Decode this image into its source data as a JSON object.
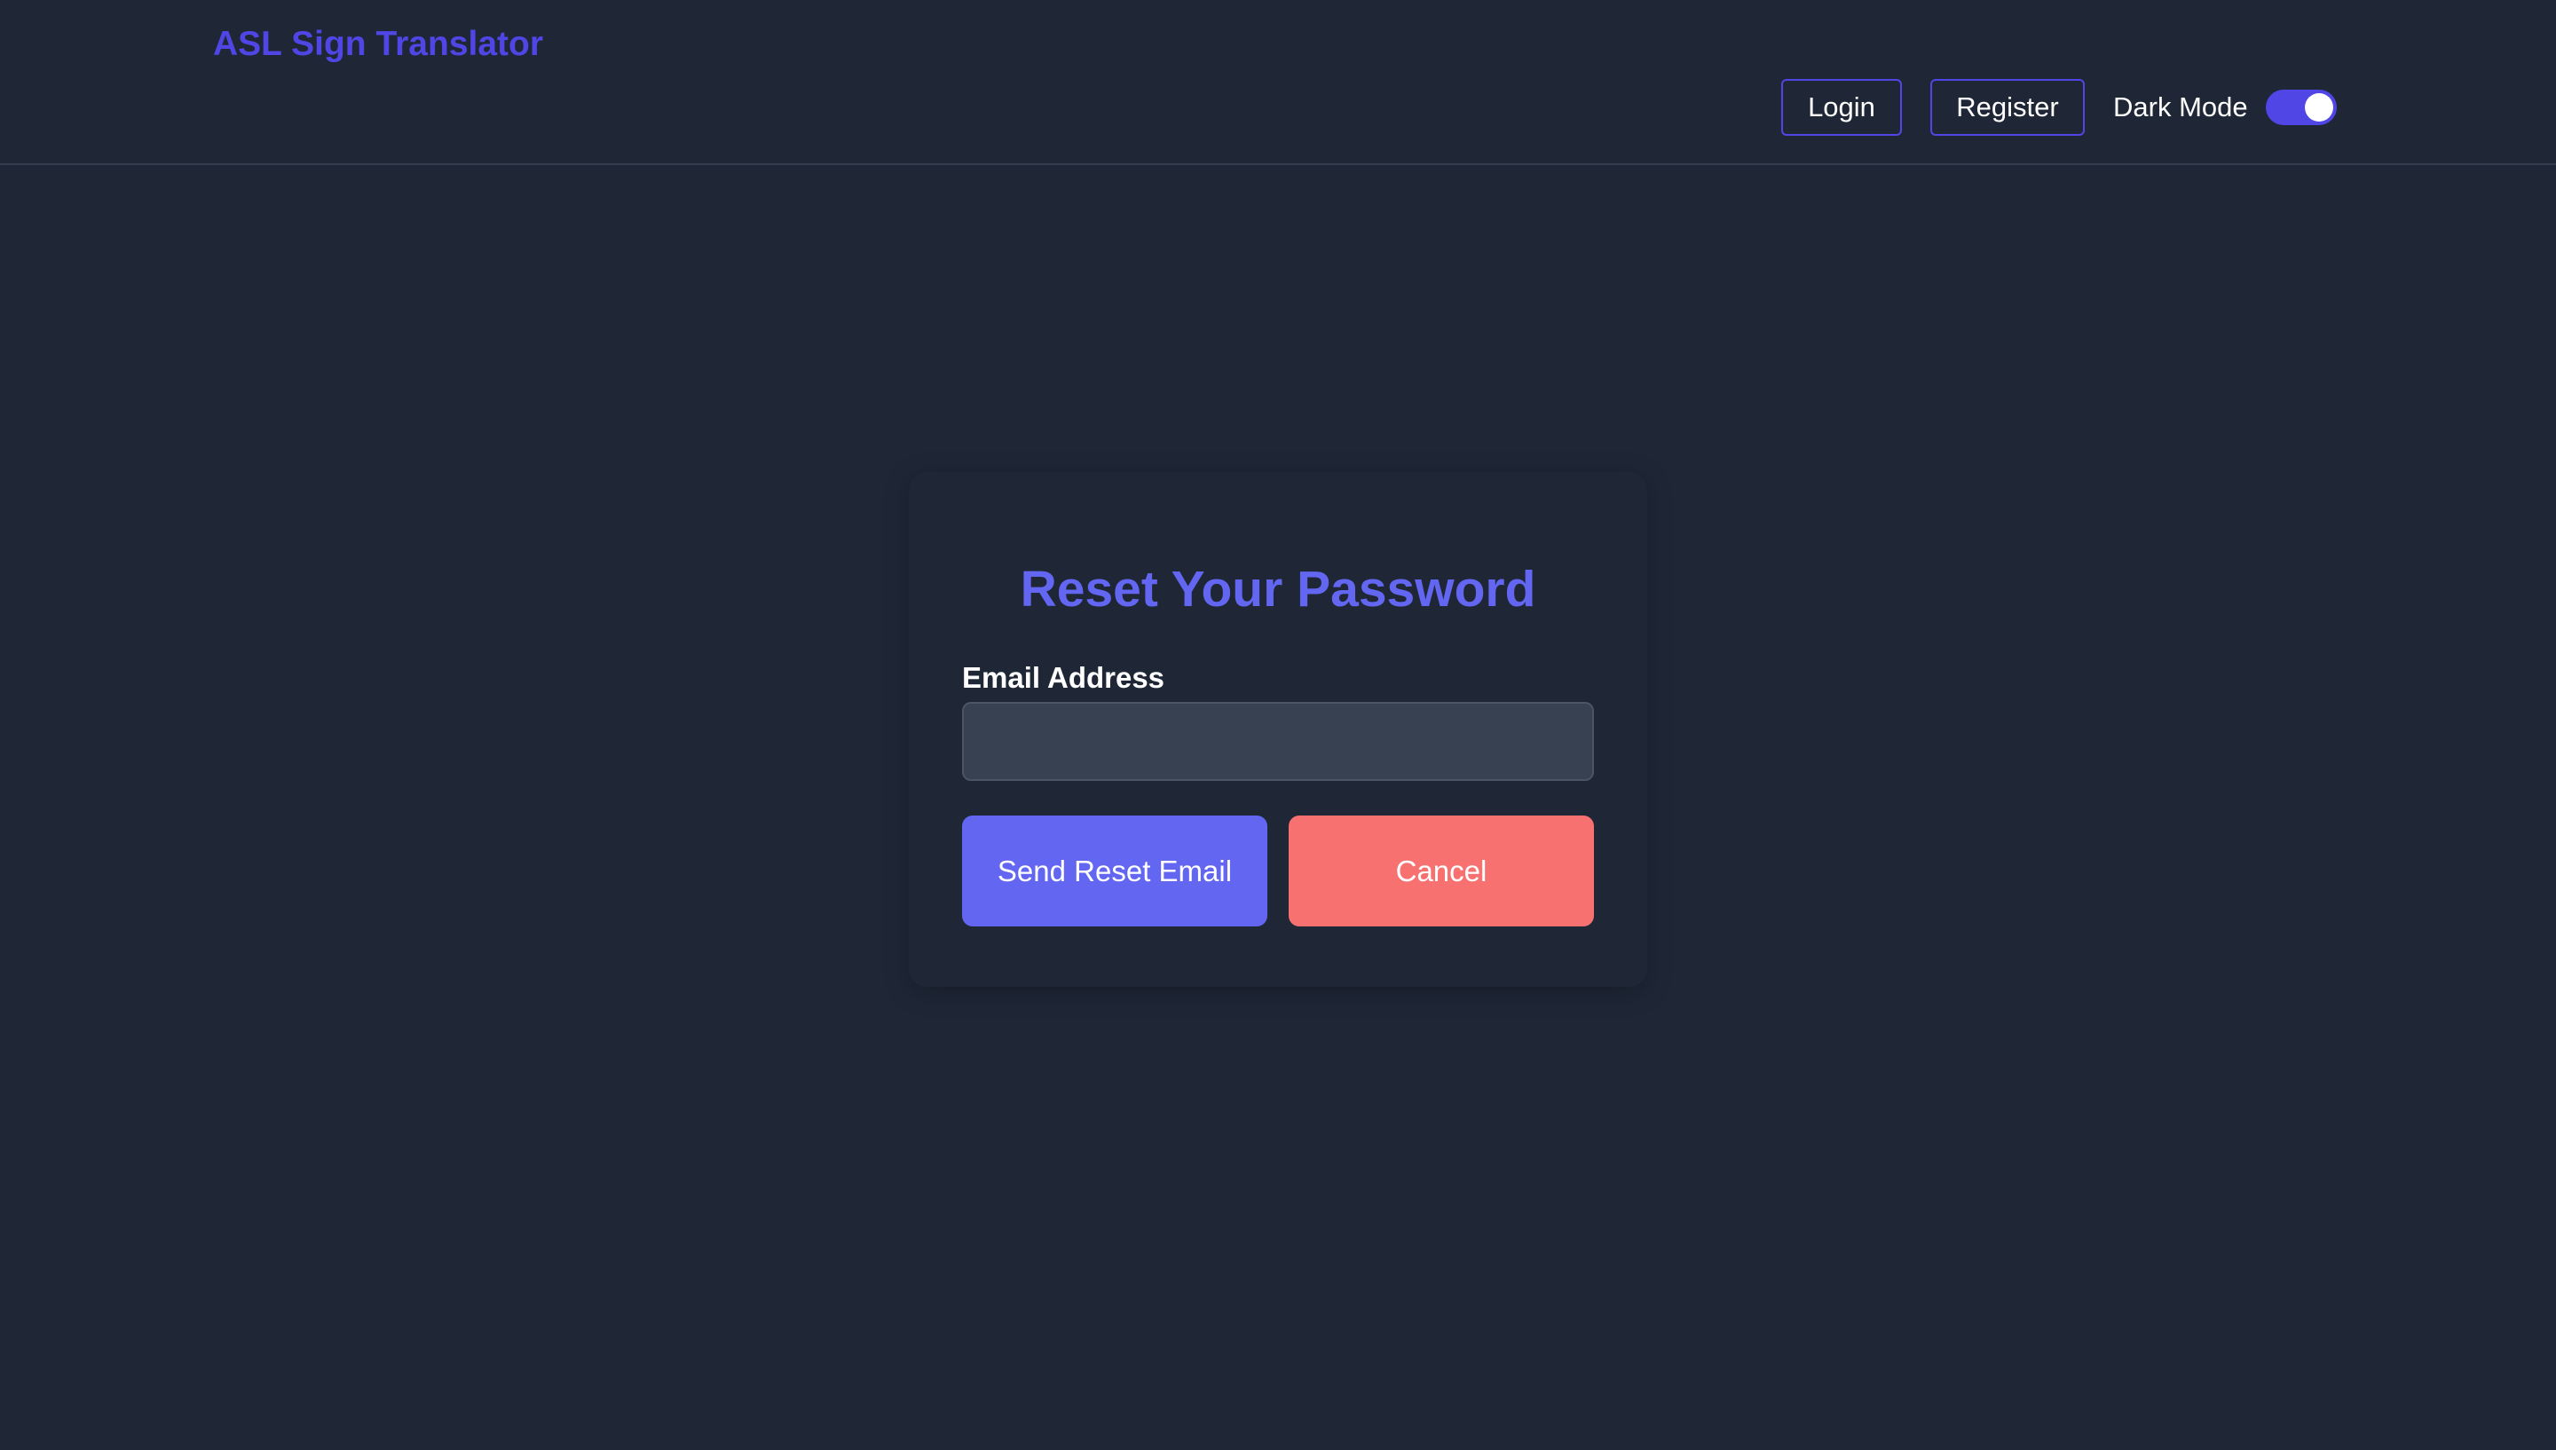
{
  "header": {
    "app_title": "ASL Sign Translator",
    "login_label": "Login",
    "register_label": "Register",
    "dark_mode_label": "Dark Mode",
    "dark_mode_on": true
  },
  "reset_form": {
    "title": "Reset Your Password",
    "email_label": "Email Address",
    "email_value": "",
    "email_placeholder": "",
    "send_label": "Send Reset Email",
    "cancel_label": "Cancel"
  },
  "colors": {
    "background": "#1f2737",
    "brand": "#4f46e5",
    "title_accent": "#6366f1",
    "primary_button": "#6366f1",
    "cancel_button": "#f87171",
    "input_background": "#374151"
  },
  "icons": {
    "dark_mode_toggle": "toggle-switch-on-icon"
  }
}
